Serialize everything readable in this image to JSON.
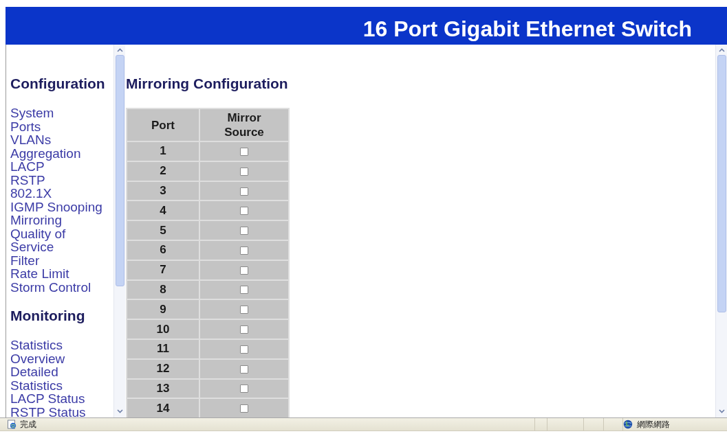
{
  "banner": {
    "title": "16 Port Gigabit Ethernet Switch"
  },
  "sidebar": {
    "sections": [
      {
        "heading": "Configuration",
        "items": [
          "System",
          "Ports",
          "VLANs",
          "Aggregation",
          "LACP",
          "RSTP",
          "802.1X",
          "IGMP Snooping",
          "Mirroring",
          "Quality of Service",
          "Filter",
          "Rate Limit",
          "Storm Control"
        ]
      },
      {
        "heading": "Monitoring",
        "items": [
          "Statistics Overview",
          "Detailed Statistics",
          "LACP Status",
          "RSTP Status"
        ]
      }
    ]
  },
  "main": {
    "title": "Mirroring Configuration",
    "table": {
      "columns": [
        "Port",
        "Mirror Source"
      ],
      "rows": [
        {
          "port": "1",
          "checked": false
        },
        {
          "port": "2",
          "checked": false
        },
        {
          "port": "3",
          "checked": false
        },
        {
          "port": "4",
          "checked": false
        },
        {
          "port": "5",
          "checked": false
        },
        {
          "port": "6",
          "checked": false
        },
        {
          "port": "7",
          "checked": false
        },
        {
          "port": "8",
          "checked": false
        },
        {
          "port": "9",
          "checked": false
        },
        {
          "port": "10",
          "checked": false
        },
        {
          "port": "11",
          "checked": false
        },
        {
          "port": "12",
          "checked": false
        },
        {
          "port": "13",
          "checked": false
        },
        {
          "port": "14",
          "checked": false
        }
      ]
    }
  },
  "status_bar": {
    "text": "完成",
    "zone": "網際網路"
  }
}
